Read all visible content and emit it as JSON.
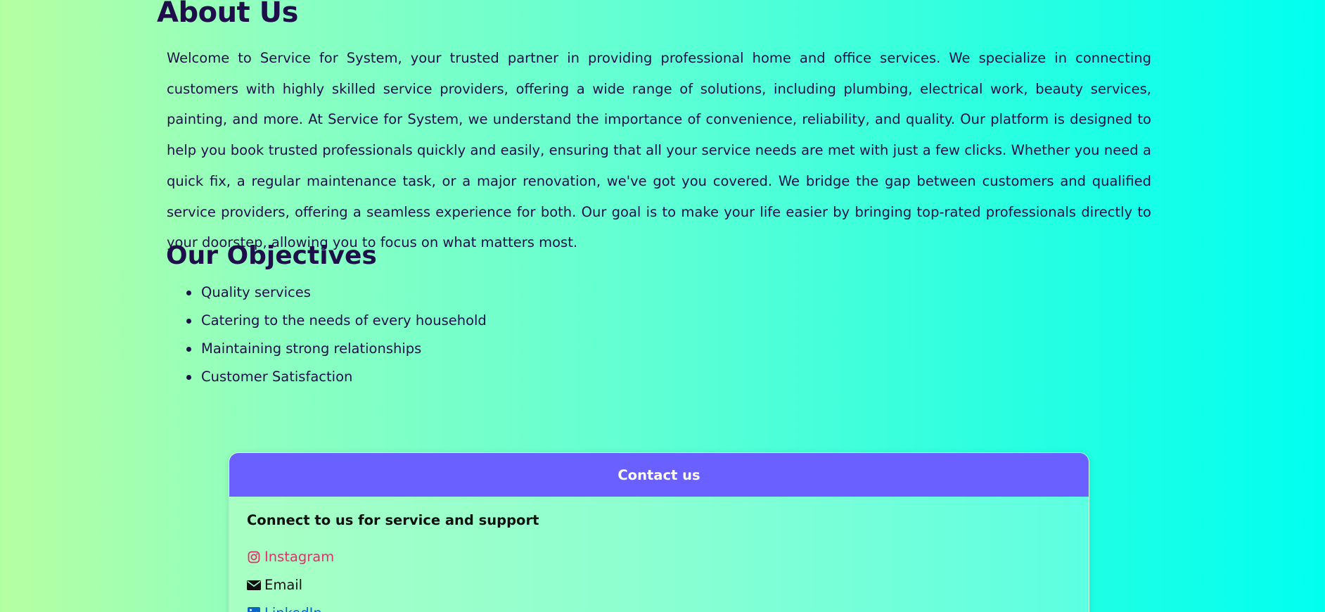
{
  "about": {
    "title": "About Us",
    "text": "Welcome to Service for System, your trusted partner in providing professional home and office services. We specialize in connecting customers with highly skilled service providers, offering a wide range of solutions, including plumbing, electrical work, beauty services, painting, and more. At Service for System, we understand the importance of convenience, reliability, and quality. Our platform is designed to help you book trusted professionals quickly and easily, ensuring that all your service needs are met with just a few clicks. Whether you need a quick fix, a regular maintenance task, or a major renovation, we've got you covered. We bridge the gap between customers and qualified service providers, offering a seamless experience for both. Our goal is to make your life easier by bringing top-rated professionals directly to your doorstep, allowing you to focus on what matters most."
  },
  "objectives": {
    "title": "Our Objectives",
    "items": [
      "Quality services",
      "Catering to the needs of every household",
      "Maintaining strong relationships",
      "Customer Satisfaction"
    ]
  },
  "contact": {
    "header": "Contact us",
    "subtitle": "Connect to us for service and support",
    "links": [
      {
        "label": "Instagram",
        "icon": "instagram-icon",
        "color": "#e1306c"
      },
      {
        "label": "Email",
        "icon": "envelope-icon",
        "color": "#111111"
      },
      {
        "label": "LinkedIn",
        "icon": "linkedin-icon",
        "color": "#0a66c2"
      }
    ]
  },
  "colors": {
    "heading": "#1e0f4a",
    "contact_header_bg": "#6a5fff"
  }
}
